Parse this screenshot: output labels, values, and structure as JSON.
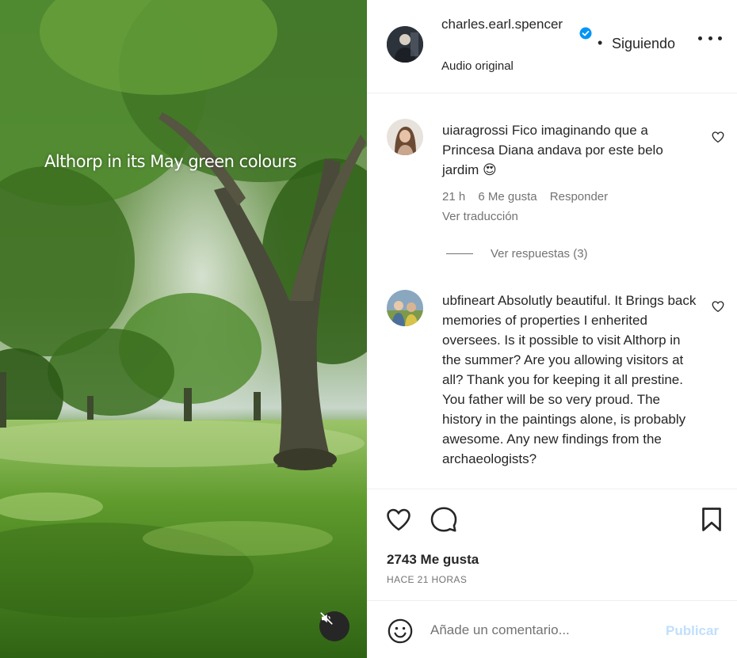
{
  "post": {
    "overlay_text": "Althorp in its May green colours",
    "author": {
      "username": "charles.earl.spencer",
      "verified": true,
      "avatar_icon": "user-avatar",
      "follow_separator": "•",
      "follow_status": "Siguiendo",
      "audio_label": "Audio original"
    },
    "likes_text": "2743 Me gusta",
    "time_ago": "HACE 21 HORAS"
  },
  "comments": [
    {
      "username": "uiaragrossi",
      "text": "Fico imaginando que a Princesa Diana andava por este belo jardim",
      "emoji": "😍",
      "time": "21 h",
      "likes": "6 Me gusta",
      "reply_label": "Responder",
      "translate_label": "Ver traducción",
      "replies_label": "Ver respuestas (3)"
    },
    {
      "username": "ubfineart",
      "text": "Absolutly beautiful. It Brings back memories of properties I enherited oversees. Is it possible to visit Althorp in the summer? Are you allowing visitors at all? Thank you for keeping it all prestine. You father will be so very proud. The history in the paintings alone, is probably awesome. Any new findings from the archaeologists?"
    }
  ],
  "composer": {
    "placeholder": "Añade un comentario...",
    "publish_label": "Publicar"
  },
  "colors": {
    "verified_blue": "#0095f6",
    "publish_disabled": "#c0dffd",
    "secondary_text": "#737373",
    "mute_button_bg": "#262626"
  },
  "icons": {
    "like": "heart-icon",
    "comment": "comment-bubble-icon",
    "save": "bookmark-icon",
    "emoji": "emoji-smiley-icon",
    "more": "more-options-icon",
    "mute": "speaker-muted-icon",
    "verified": "verified-badge-icon"
  }
}
